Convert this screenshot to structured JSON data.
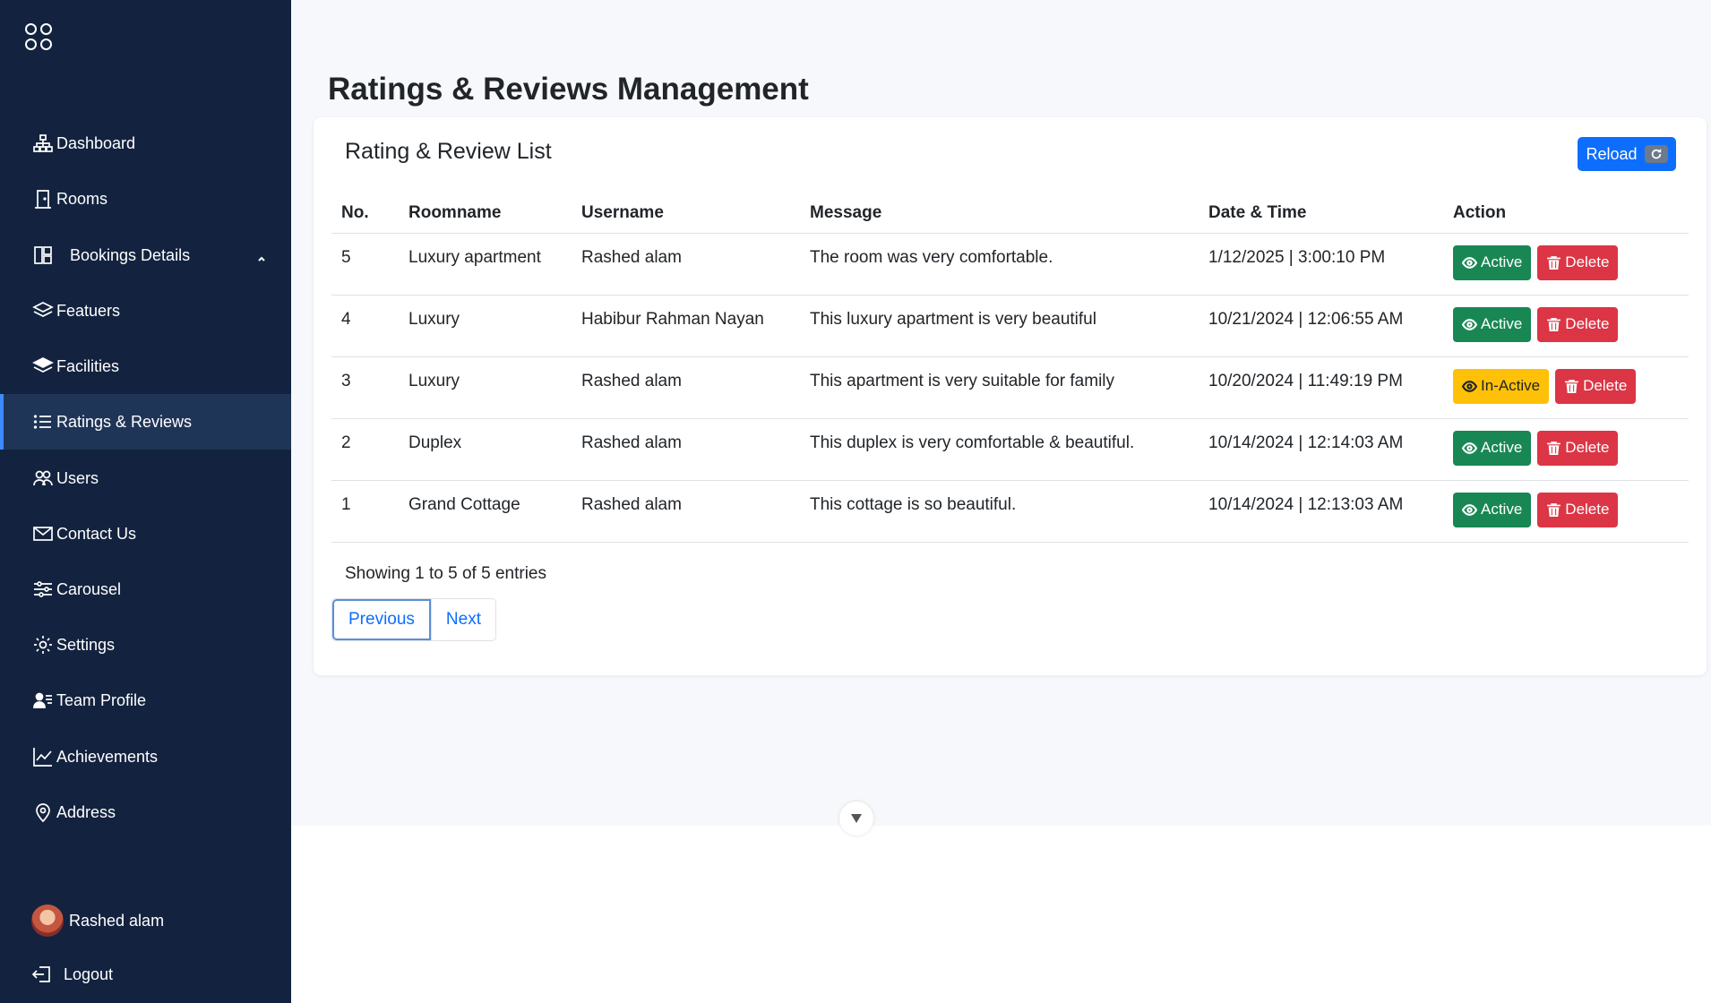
{
  "sidebar": {
    "items": [
      {
        "label": "Dashboard",
        "icon": "sitemap-icon"
      },
      {
        "label": "Rooms",
        "icon": "door-icon"
      },
      {
        "label": "Bookings Details",
        "icon": "layout-icon"
      },
      {
        "label": "Featuers",
        "icon": "layers-icon"
      },
      {
        "label": "Facilities",
        "icon": "stack-icon"
      },
      {
        "label": "Ratings & Reviews",
        "icon": "list-icon"
      },
      {
        "label": "Users",
        "icon": "users-icon"
      },
      {
        "label": "Contact Us",
        "icon": "envelope-icon"
      },
      {
        "label": "Carousel",
        "icon": "sliders-icon"
      },
      {
        "label": "Settings",
        "icon": "gear-icon"
      },
      {
        "label": "Team Profile",
        "icon": "person-lines-icon"
      },
      {
        "label": "Achievements",
        "icon": "graph-up-icon"
      },
      {
        "label": "Address",
        "icon": "geo-pin-icon"
      }
    ],
    "active_item": "Ratings & Reviews",
    "user_name": "Rashed alam",
    "logout_label": "Logout"
  },
  "page": {
    "title": "Ratings & Reviews Management"
  },
  "card": {
    "title": "Rating & Review List",
    "reload_label": "Reload"
  },
  "table": {
    "headers": {
      "no": "No.",
      "roomname": "Roomname",
      "username": "Username",
      "message": "Message",
      "datetime": "Date & Time",
      "action": "Action"
    },
    "rows": [
      {
        "no": "5",
        "roomname": "Luxury apartment",
        "username": "Rashed alam",
        "message": "The room was very comfortable.",
        "datetime": "1/12/2025 | 3:00:10 PM",
        "status_label": "Active",
        "delete_label": "Delete"
      },
      {
        "no": "4",
        "roomname": "Luxury",
        "username": "Habibur Rahman Nayan",
        "message": "This luxury apartment is very beautiful",
        "datetime": "10/21/2024 | 12:06:55 AM",
        "status_label": "Active",
        "delete_label": "Delete"
      },
      {
        "no": "3",
        "roomname": "Luxury",
        "username": "Rashed alam",
        "message": "This apartment is very suitable for family",
        "datetime": "10/20/2024 | 11:49:19 PM",
        "status_label": "In-Active",
        "delete_label": "Delete"
      },
      {
        "no": "2",
        "roomname": "Duplex",
        "username": "Rashed alam",
        "message": "This duplex is very comfortable & beautiful.",
        "datetime": "10/14/2024 | 12:14:03 AM",
        "status_label": "Active",
        "delete_label": "Delete"
      },
      {
        "no": "1",
        "roomname": "Grand Cottage",
        "username": "Rashed alam",
        "message": "This cottage is so beautiful.",
        "datetime": "10/14/2024 | 12:13:03 AM",
        "status_label": "Active",
        "delete_label": "Delete"
      }
    ]
  },
  "pagination": {
    "info": "Showing 1 to 5 of 5 entries",
    "previous_label": "Previous",
    "next_label": "Next"
  },
  "colors": {
    "sidebar_bg": "#13233f",
    "primary": "#0d6efd",
    "success": "#198754",
    "warning": "#ffc107",
    "danger": "#dc3545"
  }
}
